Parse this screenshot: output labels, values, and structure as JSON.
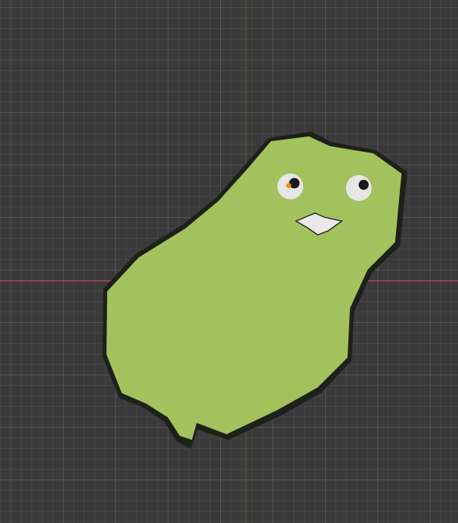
{
  "viewport": {
    "background_color": "#3a3a3a",
    "grid_color": "#4a4a4a",
    "x_axis_color": "#b5445e",
    "y_axis_color": "#6f9a2a"
  },
  "object": {
    "name": "green-blob-character",
    "body_color": "#a3c25e",
    "outline_color": "#1d2119",
    "eye_color": "#e6e6e6",
    "pupil_color": "#1a1a1a",
    "origin_color": "#ff8a00",
    "mouth_color": "#e8e8e8"
  }
}
